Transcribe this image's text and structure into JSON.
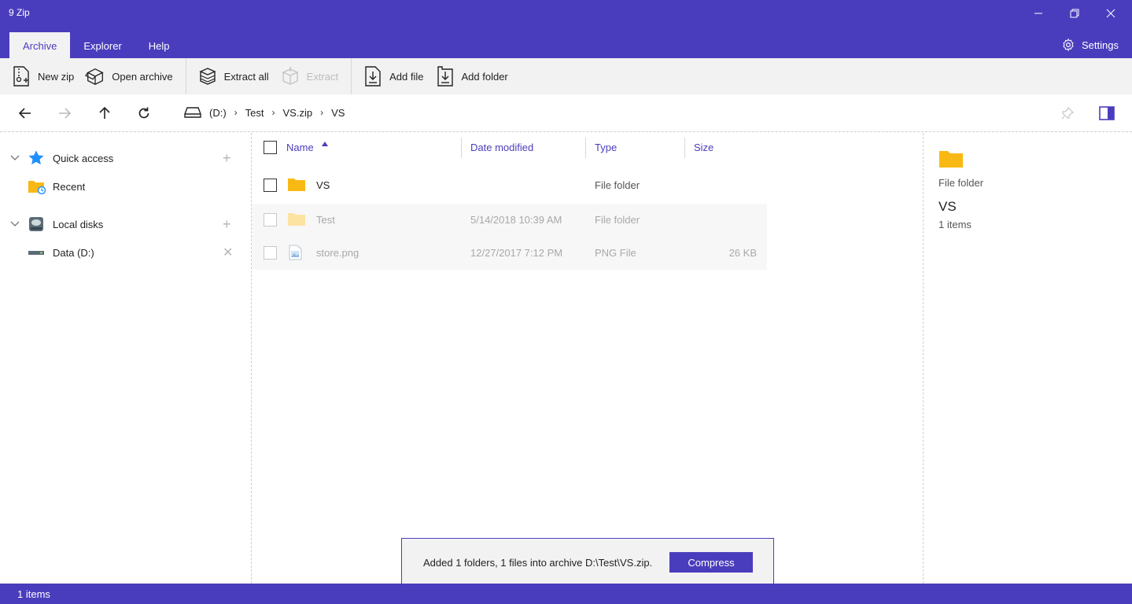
{
  "window": {
    "title": "9 Zip"
  },
  "tabs": [
    {
      "label": "Archive",
      "active": true
    },
    {
      "label": "Explorer",
      "active": false
    },
    {
      "label": "Help",
      "active": false
    }
  ],
  "settings": {
    "label": "Settings",
    "icon": "gear-icon"
  },
  "ribbon": {
    "new_zip": "New zip",
    "open_archive": "Open archive",
    "extract_all": "Extract all",
    "extract": "Extract",
    "add_file": "Add file",
    "add_folder": "Add folder"
  },
  "breadcrumb": {
    "drive": "(D:)",
    "items": [
      "Test",
      "VS.zip",
      "VS"
    ]
  },
  "sidebar": {
    "quick_access": "Quick access",
    "recent": "Recent",
    "local_disks": "Local disks",
    "data_drive": "Data (D:)"
  },
  "columns": {
    "name": "Name",
    "date": "Date modified",
    "type": "Type",
    "size": "Size"
  },
  "files": [
    {
      "name": "VS",
      "date": "",
      "type": "File folder",
      "size": ""
    },
    {
      "name": "Test",
      "date": "5/14/2018 10:39 AM",
      "type": "File folder",
      "size": ""
    },
    {
      "name": "store.png",
      "date": "12/27/2017 7:12 PM",
      "type": "PNG File",
      "size": "26 KB"
    }
  ],
  "details": {
    "kind": "File folder",
    "name": "VS",
    "count": "1 items"
  },
  "toast": {
    "message": "Added 1 folders, 1 files into archive D:\\Test\\VS.zip.",
    "button": "Compress"
  },
  "status": {
    "text": "1 items"
  },
  "colors": {
    "accent": "#4a3dbd",
    "folder": "#f9b914",
    "star": "#1e90ff"
  }
}
